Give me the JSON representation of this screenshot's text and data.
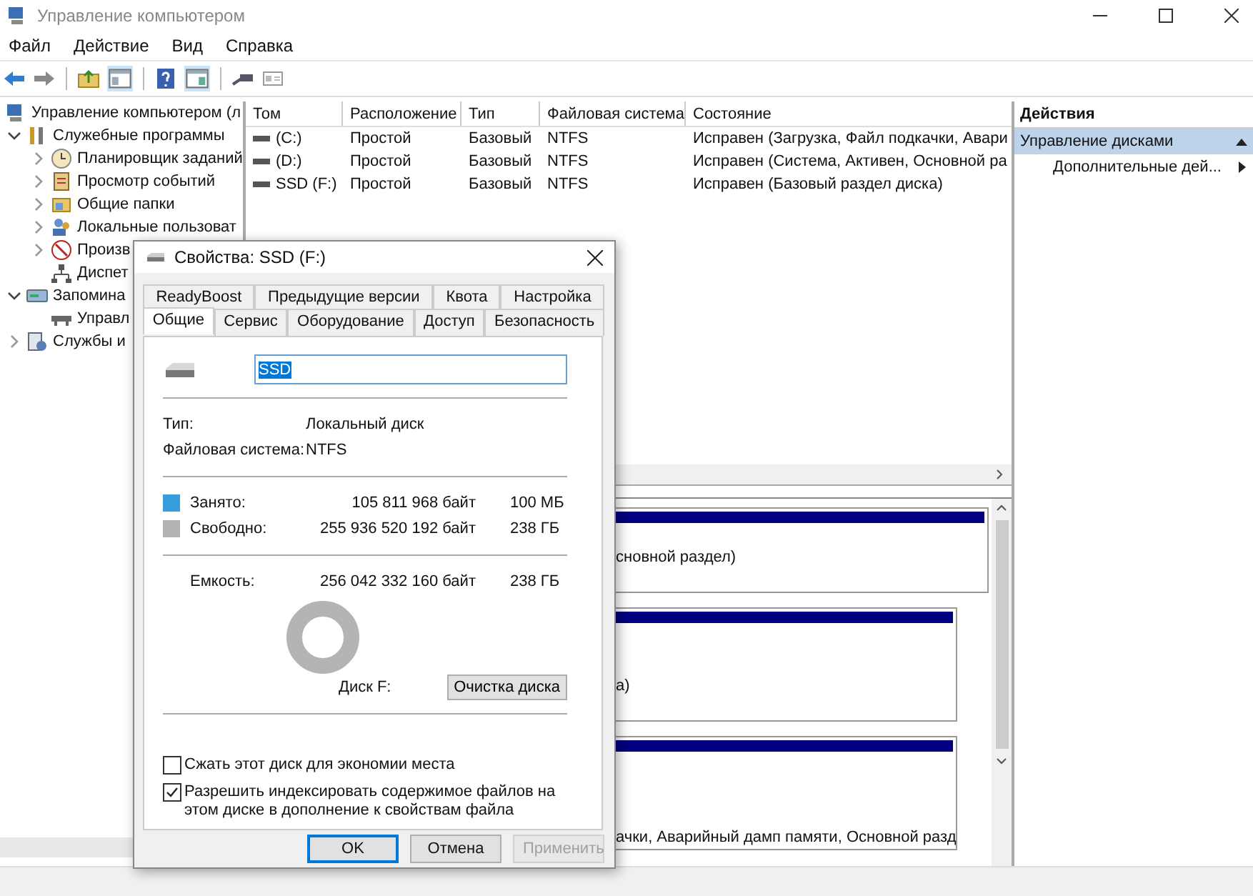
{
  "window": {
    "title": "Управление компьютером"
  },
  "menu": [
    "Файл",
    "Действие",
    "Вид",
    "Справка"
  ],
  "tree": [
    {
      "label": "Управление компьютером (л",
      "kind": "root",
      "children": [
        {
          "label": "Служебные программы",
          "kind": "node",
          "expanded": true,
          "children": [
            {
              "label": "Планировщик заданий",
              "kind": "node",
              "expanded": false
            },
            {
              "label": "Просмотр событий",
              "kind": "node",
              "expanded": false
            },
            {
              "label": "Общие папки",
              "kind": "node",
              "expanded": false
            },
            {
              "label": "Локальные пользоват",
              "kind": "node",
              "expanded": false
            },
            {
              "label": "Произв",
              "kind": "node",
              "expanded": false
            },
            {
              "label": "Диспет",
              "kind": "leaf"
            }
          ]
        },
        {
          "label": "Запомина",
          "kind": "node",
          "expanded": true,
          "children": [
            {
              "label": "Управл",
              "kind": "leaf"
            }
          ]
        },
        {
          "label": "Службы и",
          "kind": "node",
          "expanded": false
        }
      ]
    }
  ],
  "table": {
    "columns": [
      "Том",
      "Расположение",
      "Тип",
      "Файловая система",
      "Состояние"
    ],
    "rows": [
      [
        "(C:)",
        "Простой",
        "Базовый",
        "NTFS",
        "Исправен (Загрузка, Файл подкачки, Авари"
      ],
      [
        "(D:)",
        "Простой",
        "Базовый",
        "NTFS",
        "Исправен (Система, Активен, Основной ра"
      ],
      [
        "SSD (F:)",
        "Простой",
        "Базовый",
        "NTFS",
        "Исправен (Базовый раздел диска)"
      ]
    ]
  },
  "disk_map": [
    {
      "text": "сновной раздел)"
    },
    {
      "text": "а)"
    },
    {
      "text": "ачки, Аварийный дамп памяти, Основной разд"
    }
  ],
  "actions": {
    "title": "Действия",
    "items": [
      {
        "label": "Управление дисками",
        "selected": true
      },
      {
        "label": "Дополнительные дей...",
        "selected": false
      }
    ]
  },
  "dialog": {
    "title": "Свойства: SSD (F:)",
    "tab_rows": [
      [
        {
          "label": "ReadyBoost",
          "selected": false
        },
        {
          "label": "Предыдущие версии",
          "selected": false
        },
        {
          "label": "Квота",
          "selected": false
        },
        {
          "label": "Настройка",
          "selected": false
        }
      ],
      [
        {
          "label": "Общие",
          "selected": true
        },
        {
          "label": "Сервис",
          "selected": false
        },
        {
          "label": "Оборудование",
          "selected": false
        },
        {
          "label": "Доступ",
          "selected": false
        },
        {
          "label": "Безопасность",
          "selected": false
        }
      ]
    ],
    "name": "SSD",
    "info": [
      {
        "label": "Тип:",
        "value": "Локальный диск"
      },
      {
        "label": "Файловая система:",
        "value": "NTFS"
      }
    ],
    "usage": [
      {
        "label": "Занято:",
        "bytes": "105 811 968 байт",
        "size": "100 МБ",
        "color": "#3a9ddb"
      },
      {
        "label": "Свободно:",
        "bytes": "255 936 520 192 байт",
        "size": "238 ГБ",
        "color": "#b4b4b4"
      }
    ],
    "capacity": {
      "label": "Емкость:",
      "bytes": "256 042 332 160 байт",
      "size": "238 ГБ"
    },
    "disk_label": "Диск F:",
    "cleanup_button": "Очистка диска",
    "options": [
      {
        "label": "Сжать этот диск для экономии места",
        "checked": false
      },
      {
        "label": "Разрешить индексировать содержимое файлов на этом диске в дополнение к свойствам файла",
        "checked": true
      }
    ],
    "buttons": [
      {
        "label": "OK",
        "default": true,
        "disabled": false
      },
      {
        "label": "Отмена",
        "default": false,
        "disabled": false
      },
      {
        "label": "Применить",
        "default": false,
        "disabled": true
      }
    ]
  }
}
